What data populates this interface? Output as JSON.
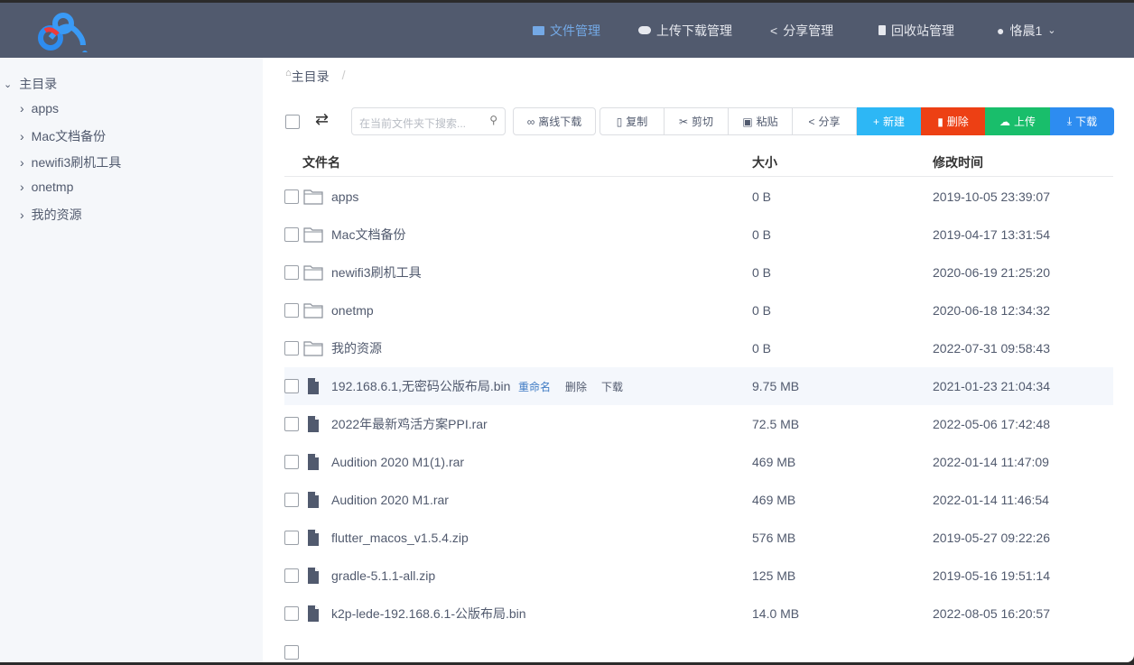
{
  "header": {
    "nav": [
      {
        "label": "文件管理",
        "icon": "folder-icon",
        "active": true
      },
      {
        "label": "上传下载管理",
        "icon": "cloud-icon"
      },
      {
        "label": "分享管理",
        "icon": "share-icon"
      },
      {
        "label": "回收站管理",
        "icon": "trash-icon"
      },
      {
        "label": "恪晨1",
        "icon": "user-icon"
      }
    ]
  },
  "sidebar": {
    "root": "主目录",
    "items": [
      "apps",
      "Mac文档备份",
      "newifi3刷机工具",
      "onetmp",
      "我的资源"
    ]
  },
  "breadcrumb": {
    "home": "主目录",
    "sep": "/"
  },
  "toolbar": {
    "search_placeholder": "在当前文件夹下搜索...",
    "offline": "离线下载",
    "copy": "复制",
    "cut": "剪切",
    "paste": "粘贴",
    "share": "分享",
    "new": "新建",
    "delete": "删除",
    "upload": "上传",
    "download": "下载",
    "colors": {
      "new": "#2db7f5",
      "delete": "#ed4014",
      "upload": "#19be6b",
      "download": "#2d8cf0"
    }
  },
  "table": {
    "headers": {
      "name": "文件名",
      "size": "大小",
      "time": "修改时间"
    },
    "row_actions": {
      "rename": "重命名",
      "delete": "删除",
      "download": "下载"
    },
    "rows": [
      {
        "type": "folder",
        "name": "apps",
        "size": "0 B",
        "time": "2019-10-05 23:39:07"
      },
      {
        "type": "folder",
        "name": "Mac文档备份",
        "size": "0 B",
        "time": "2019-04-17 13:31:54"
      },
      {
        "type": "folder",
        "name": "newifi3刷机工具",
        "size": "0 B",
        "time": "2020-06-19 21:25:20"
      },
      {
        "type": "folder",
        "name": "onetmp",
        "size": "0 B",
        "time": "2020-06-18 12:34:32"
      },
      {
        "type": "folder",
        "name": "我的资源",
        "size": "0 B",
        "time": "2022-07-31 09:58:43"
      },
      {
        "type": "file",
        "name": "192.168.6.1,无密码公版布局.bin",
        "size": "9.75 MB",
        "time": "2021-01-23 21:04:34",
        "hover": true
      },
      {
        "type": "file",
        "name": "2022年最新鸡活方案PPI.rar",
        "size": "72.5 MB",
        "time": "2022-05-06 17:42:48"
      },
      {
        "type": "file",
        "name": "Audition 2020 M1(1).rar",
        "size": "469 MB",
        "time": "2022-01-14 11:47:09"
      },
      {
        "type": "file",
        "name": "Audition 2020 M1.rar",
        "size": "469 MB",
        "time": "2022-01-14 11:46:54"
      },
      {
        "type": "file",
        "name": "flutter_macos_v1.5.4.zip",
        "size": "576 MB",
        "time": "2019-05-27 09:22:26"
      },
      {
        "type": "file",
        "name": "gradle-5.1.1-all.zip",
        "size": "125 MB",
        "time": "2019-05-16 19:51:14"
      },
      {
        "type": "file",
        "name": "k2p-lede-192.168.6.1-公版布局.bin",
        "size": "14.0 MB",
        "time": "2022-08-05 16:20:57"
      }
    ]
  }
}
